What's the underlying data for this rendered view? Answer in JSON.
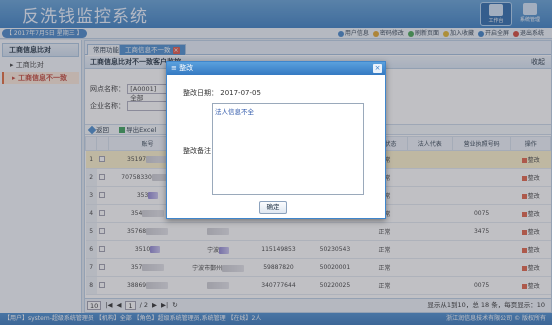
{
  "app": {
    "title": "反洗钱监控系统"
  },
  "header_buttons": [
    {
      "label": "工作台",
      "active": true,
      "icon": "workbench-icon"
    },
    {
      "label": "系统管理",
      "active": false,
      "icon": "system-icon"
    }
  ],
  "infobar": {
    "date": "【 2017年7月5日 星期三 】",
    "links": [
      {
        "label": "用户信息",
        "icon": "user-icon",
        "color": "#3a7fc6"
      },
      {
        "label": "密码修改",
        "icon": "key-icon",
        "color": "#e0a020"
      },
      {
        "label": "刷新页面",
        "icon": "refresh-icon",
        "color": "#3aa04a"
      },
      {
        "label": "加入收藏",
        "icon": "star-icon",
        "color": "#e0b020"
      },
      {
        "label": "开启全屏",
        "icon": "fullscreen-icon",
        "color": "#2f78c0"
      },
      {
        "label": "退出系统",
        "icon": "logout-icon",
        "color": "#d03a2a"
      }
    ]
  },
  "sidebar": {
    "heading": "工商信息比对",
    "items": [
      {
        "label": "工商比对",
        "active": false
      },
      {
        "label": "工商信息不一致",
        "active": true
      }
    ]
  },
  "tabs": [
    {
      "label": "常用功能",
      "active": false
    },
    {
      "label": "工商信息不一致",
      "active": true,
      "close": "×"
    }
  ],
  "panel": {
    "title": "工商信息比对不一致客户监控",
    "collapse": "收起",
    "filters": {
      "org_label": "网点名称：",
      "org_value": "[A0001] 全部",
      "company_label": "企业名称："
    },
    "toolbar": [
      {
        "label": "返回",
        "icon": "back-icon"
      },
      {
        "label": "导出Excel",
        "icon": "excel-icon"
      }
    ]
  },
  "grid": {
    "columns": [
      "",
      "",
      "账号",
      "",
      "",
      "",
      "账户状态",
      "法人代表",
      "营业执照号码",
      "操作"
    ],
    "rows": [
      {
        "n": "1",
        "code": "35197",
        "status": "正常",
        "action": "整改",
        "sel": true,
        "col4": "",
        "col5": "",
        "col6": "",
        "legal": "",
        "license": ""
      },
      {
        "n": "2",
        "code": "70758330",
        "status": "正常",
        "action": "整改",
        "sel": false,
        "col4": "",
        "col5": "",
        "col6": "",
        "legal": "",
        "license": ""
      },
      {
        "n": "3",
        "code": "353",
        "status": "正常",
        "action": "整改",
        "sel": false,
        "col4": "",
        "col5": "",
        "col6": "",
        "legal": "",
        "license": ""
      },
      {
        "n": "4",
        "code": "354",
        "status": "正常",
        "action": "整改",
        "sel": false,
        "col4": "",
        "col5": "",
        "col6": "",
        "legal": "",
        "license": "0075"
      },
      {
        "n": "5",
        "code": "35768",
        "status": "正常",
        "action": "整改",
        "sel": false,
        "col4": "",
        "col5": "",
        "col6": "",
        "legal": "",
        "license": "3475"
      },
      {
        "n": "6",
        "code": "3510",
        "status": "正常",
        "action": "整改",
        "sel": false,
        "col4": "宁波",
        "col5": "115149853",
        "col6": "50230543",
        "legal": "",
        "license": ""
      },
      {
        "n": "7",
        "code": "357",
        "status": "正常",
        "action": "整改",
        "sel": false,
        "col4": "宁波市鄞州",
        "col5": "59887820",
        "col6": "50020001",
        "legal": "",
        "license": ""
      },
      {
        "n": "8",
        "code": "38869",
        "status": "正常",
        "action": "整改",
        "sel": false,
        "col4": "",
        "col5": "340777644",
        "col6": "50220025",
        "legal": "",
        "license": "0075"
      }
    ]
  },
  "pager": {
    "page_size": "10",
    "page": "1",
    "total_pages": "/ 2",
    "summary": "显示从1到10，总 18 条，每页显示：10"
  },
  "statusbar": {
    "left": "【用户】system-超级系统管理员  【机构】全部  【角色】超级系统管理员,系统管理  【在线】2人",
    "right": "浙江润信息技术有限公司 © 版权所有"
  },
  "modal": {
    "title": "整改",
    "close": "×",
    "date_label": "整改日期：",
    "date_value": "2017-07-05",
    "note_label": "整改备注：",
    "note_value": "法人信息不全",
    "ok": "确定"
  }
}
